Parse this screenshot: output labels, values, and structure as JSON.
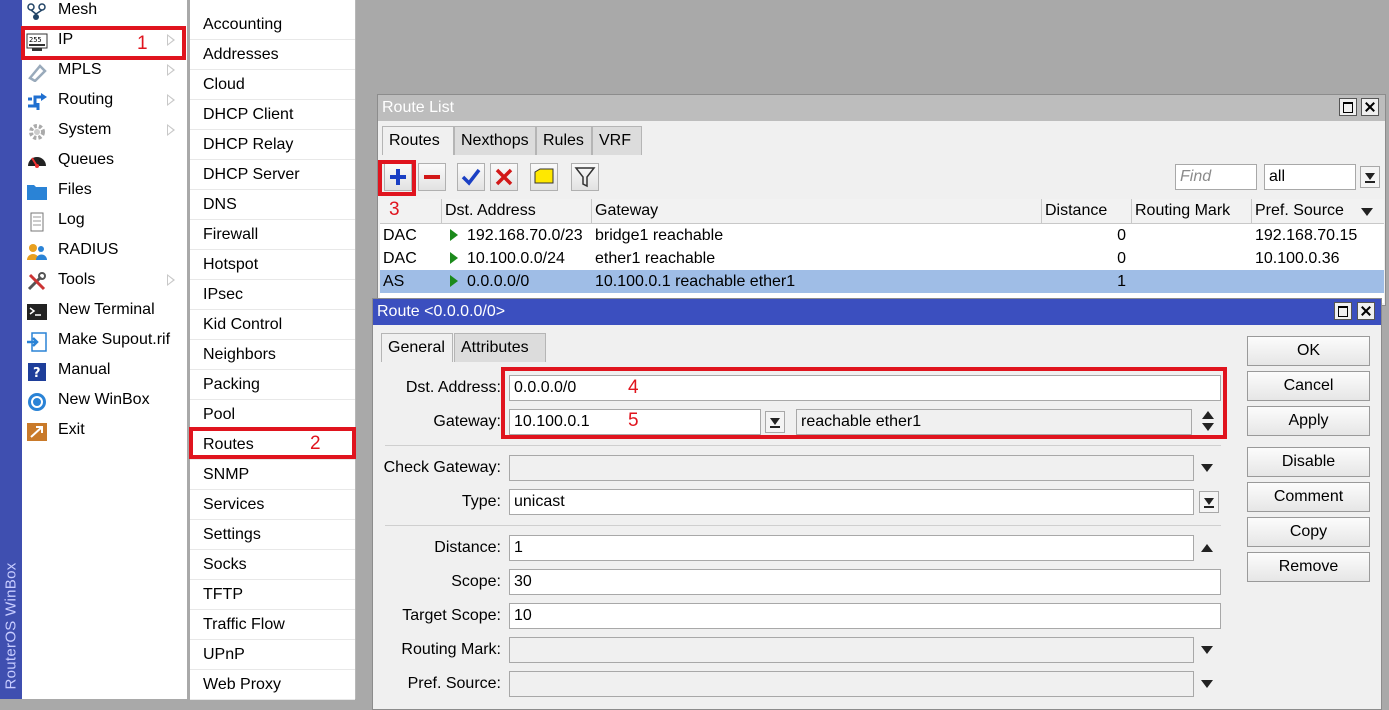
{
  "brand": "RouterOS WinBox",
  "main_menu": [
    {
      "label": "Mesh",
      "icon": "mesh-icon"
    },
    {
      "label": "IP",
      "icon": "ip-icon",
      "submenu": true
    },
    {
      "label": "MPLS",
      "icon": "mpls-icon",
      "submenu": true
    },
    {
      "label": "Routing",
      "icon": "routing-icon",
      "submenu": true
    },
    {
      "label": "System",
      "icon": "gear-icon",
      "submenu": true
    },
    {
      "label": "Queues",
      "icon": "queues-icon"
    },
    {
      "label": "Files",
      "icon": "folder-icon"
    },
    {
      "label": "Log",
      "icon": "log-icon"
    },
    {
      "label": "RADIUS",
      "icon": "radius-icon"
    },
    {
      "label": "Tools",
      "icon": "tools-icon",
      "submenu": true
    },
    {
      "label": "New Terminal",
      "icon": "terminal-icon"
    },
    {
      "label": "Make Supout.rif",
      "icon": "supout-icon"
    },
    {
      "label": "Manual",
      "icon": "manual-icon"
    },
    {
      "label": "New WinBox",
      "icon": "winbox-icon"
    },
    {
      "label": "Exit",
      "icon": "exit-icon"
    }
  ],
  "ip_submenu": [
    "Accounting",
    "Addresses",
    "Cloud",
    "DHCP Client",
    "DHCP Relay",
    "DHCP Server",
    "DNS",
    "Firewall",
    "Hotspot",
    "IPsec",
    "Kid Control",
    "Neighbors",
    "Packing",
    "Pool",
    "Routes",
    "SNMP",
    "Services",
    "Settings",
    "Socks",
    "TFTP",
    "Traffic Flow",
    "UPnP",
    "Web Proxy"
  ],
  "annotations": {
    "n1": "1",
    "n2": "2",
    "n3": "3",
    "n4": "4",
    "n5": "5"
  },
  "route_list": {
    "title": "Route List",
    "tabs": [
      "Routes",
      "Nexthops",
      "Rules",
      "VRF"
    ],
    "find_placeholder": "Find",
    "filter_value": "all",
    "columns": [
      "Dst. Address",
      "Gateway",
      "Distance",
      "Routing Mark",
      "Pref. Source"
    ],
    "rows": [
      {
        "flags": "DAC",
        "dst": "192.168.70.0/23",
        "gateway": "bridge1 reachable",
        "distance": "0",
        "mark": "",
        "pref_source": "192.168.70.15"
      },
      {
        "flags": "DAC",
        "dst": "10.100.0.0/24",
        "gateway": "ether1 reachable",
        "distance": "0",
        "mark": "",
        "pref_source": "10.100.0.36"
      },
      {
        "flags": "AS",
        "dst": "0.0.0.0/0",
        "gateway": "10.100.0.1 reachable ether1",
        "distance": "1",
        "mark": "",
        "pref_source": ""
      }
    ]
  },
  "route_dialog": {
    "title": "Route <0.0.0.0/0>",
    "tabs": [
      "General",
      "Attributes"
    ],
    "labels": {
      "dst": "Dst. Address:",
      "gateway": "Gateway:",
      "check_gateway": "Check Gateway:",
      "type": "Type:",
      "distance": "Distance:",
      "scope": "Scope:",
      "target_scope": "Target Scope:",
      "routing_mark": "Routing Mark:",
      "pref_source": "Pref. Source:"
    },
    "values": {
      "dst": "0.0.0.0/0",
      "gateway": "10.100.0.1",
      "gateway_status": "reachable ether1",
      "check_gateway": "",
      "type": "unicast",
      "distance": "1",
      "scope": "30",
      "target_scope": "10",
      "routing_mark": "",
      "pref_source": ""
    },
    "buttons": [
      "OK",
      "Cancel",
      "Apply",
      "Disable",
      "Comment",
      "Copy",
      "Remove"
    ]
  },
  "colors": {
    "titlebar_inactive": "#bdbdbd",
    "titlebar_active": "#3b4fbf",
    "selected_row": "#9fbde6",
    "annotation": "#e0141e"
  }
}
